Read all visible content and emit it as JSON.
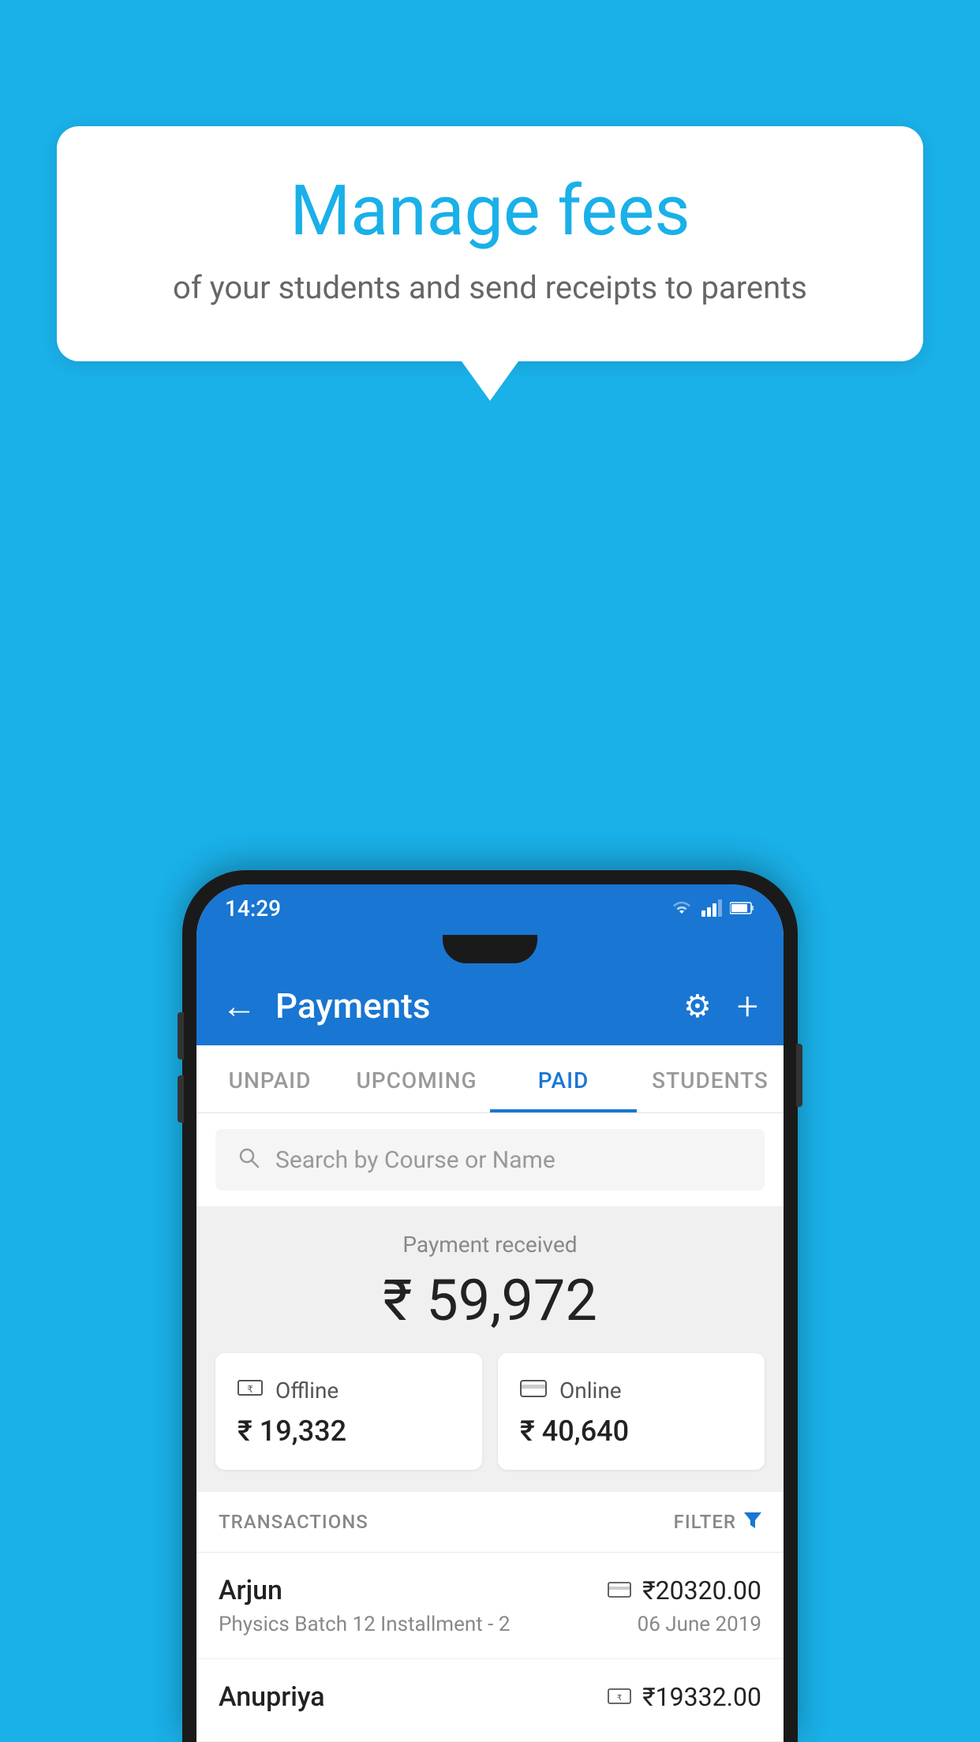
{
  "background_color": "#1ab0e8",
  "speech_bubble": {
    "title": "Manage fees",
    "subtitle": "of your students and send receipts to parents"
  },
  "status_bar": {
    "time": "14:29",
    "icons": [
      "wifi",
      "signal",
      "battery"
    ]
  },
  "app_bar": {
    "title": "Payments",
    "back_icon": "←",
    "settings_icon": "⚙",
    "add_icon": "+"
  },
  "tabs": [
    {
      "label": "UNPAID",
      "active": false
    },
    {
      "label": "UPCOMING",
      "active": false
    },
    {
      "label": "PAID",
      "active": true
    },
    {
      "label": "STUDENTS",
      "active": false
    }
  ],
  "search": {
    "placeholder": "Search by Course or Name"
  },
  "payment_summary": {
    "label": "Payment received",
    "amount": "₹ 59,972",
    "offline": {
      "label": "Offline",
      "amount": "₹ 19,332"
    },
    "online": {
      "label": "Online",
      "amount": "₹ 40,640"
    }
  },
  "transactions": {
    "header_label": "TRANSACTIONS",
    "filter_label": "FILTER",
    "items": [
      {
        "name": "Arjun",
        "payment_type": "online",
        "amount": "₹20320.00",
        "description": "Physics Batch 12 Installment - 2",
        "date": "06 June 2019"
      },
      {
        "name": "Anupriya",
        "payment_type": "offline",
        "amount": "₹19332.00",
        "description": "",
        "date": ""
      }
    ]
  }
}
